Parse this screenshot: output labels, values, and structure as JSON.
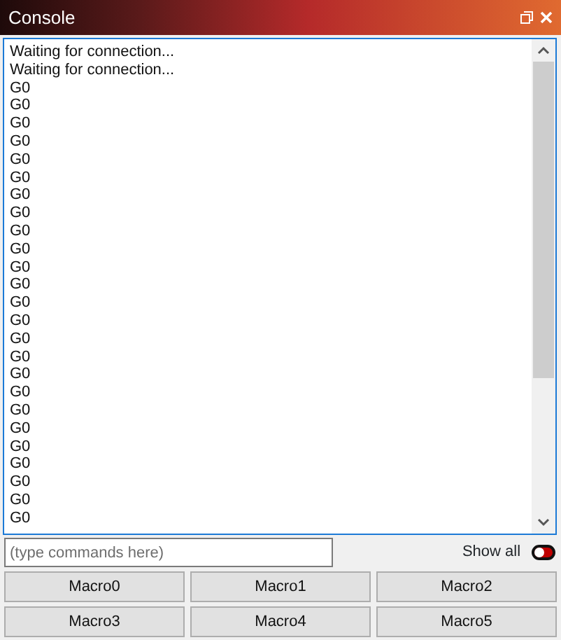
{
  "window": {
    "title": "Console"
  },
  "console": {
    "lines": [
      "Waiting for connection...",
      "Waiting for connection...",
      "G0",
      "G0",
      "G0",
      "G0",
      "G0",
      "G0",
      "G0",
      "G0",
      "G0",
      "G0",
      "G0",
      "G0",
      "G0",
      "G0",
      "G0",
      "G0",
      "G0",
      "G0",
      "G0",
      "G0",
      "G0",
      "G0",
      "G0",
      "G0",
      "G0"
    ]
  },
  "command_input": {
    "placeholder": "(type commands here)"
  },
  "show_all": {
    "label": "Show all",
    "on": false
  },
  "macros": [
    "Macro0",
    "Macro1",
    "Macro2",
    "Macro3",
    "Macro4",
    "Macro5"
  ]
}
